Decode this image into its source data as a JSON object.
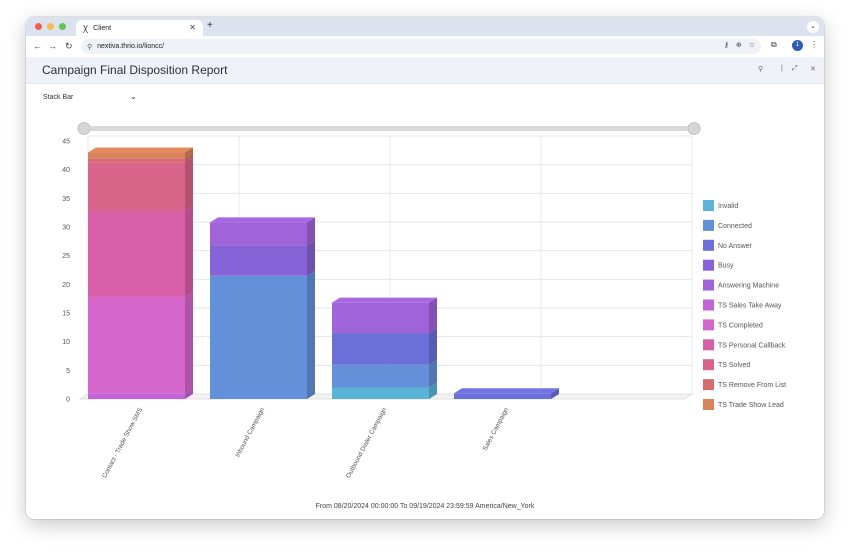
{
  "browser": {
    "tab_title": "Client",
    "tab_favicon": "thrio-icon",
    "url": "nextiva.thrio.io/lioncc/",
    "profile_initial": "1"
  },
  "app": {
    "report_title": "Campaign Final Disposition Report",
    "chart_type_select": "Stack Bar",
    "footer_range": "From 08/20/2024 00:00:00 To 09/19/2024 23:59:59 America/New_York"
  },
  "chart_data": {
    "type": "bar",
    "stacked": true,
    "three_d": true,
    "categories": [
      "Contact - Trade Show SMS",
      "Inbound Campaign",
      "Outbound Dialer Campaign",
      "Sales Campaign"
    ],
    "ylim": [
      0,
      45
    ],
    "yticks": [
      0,
      5,
      10,
      15,
      20,
      25,
      30,
      35,
      40,
      45
    ],
    "grid": true,
    "legend_position": "right",
    "series": [
      {
        "name": "Invalid",
        "color": "#5ab4d8",
        "values": [
          0,
          0,
          2,
          0
        ]
      },
      {
        "name": "Connected",
        "color": "#6390d8",
        "values": [
          0,
          21.5,
          4,
          0
        ]
      },
      {
        "name": "No Answer",
        "color": "#6b6fd8",
        "values": [
          0,
          0,
          5.5,
          1
        ]
      },
      {
        "name": "Busy",
        "color": "#8663d6",
        "values": [
          0,
          5.3,
          0,
          0
        ]
      },
      {
        "name": "Answering Machine",
        "color": "#a063d8",
        "values": [
          0,
          4,
          5.3,
          0
        ]
      },
      {
        "name": "TS Sales Take Away",
        "color": "#c463d8",
        "values": [
          1,
          0,
          0,
          0
        ]
      },
      {
        "name": "TS Completed",
        "color": "#d466cc",
        "values": [
          16.8,
          0,
          0,
          0
        ]
      },
      {
        "name": "TS Personal Callback",
        "color": "#d860a8",
        "values": [
          15,
          0,
          0,
          0
        ]
      },
      {
        "name": "TS Solved",
        "color": "#d8648a",
        "values": [
          8.5,
          0,
          0,
          0
        ]
      },
      {
        "name": "TS Remove From List",
        "color": "#d86c6c",
        "values": [
          0.7,
          0,
          0,
          0
        ]
      },
      {
        "name": "TS Trade Show Lead",
        "color": "#d8845a",
        "values": [
          1,
          0,
          0,
          0
        ]
      }
    ]
  }
}
